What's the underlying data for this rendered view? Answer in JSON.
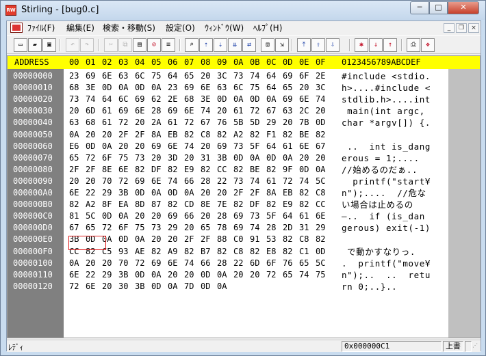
{
  "window": {
    "title": "Stirling - [bug0.c]"
  },
  "title_buttons": {
    "minimize": "─",
    "maximize": "□",
    "close": "✕"
  },
  "menu": {
    "items": [
      "ﾌｧｲﾙ(F)",
      "編集(E)",
      "検索・移動(S)",
      "設定(O)",
      "ｳｨﾝﾄﾞｳ(W)",
      "ﾍﾙﾌﾟ(H)"
    ],
    "mdi_buttons": [
      "_",
      "❐",
      "×"
    ]
  },
  "toolbar": {
    "buttons": [
      {
        "icon": "new-file-icon",
        "glyph": "▭",
        "style": ""
      },
      {
        "icon": "open-folder-icon",
        "glyph": "▰",
        "style": ""
      },
      {
        "icon": "save-icon",
        "glyph": "▣",
        "style": ""
      },
      {
        "icon": "undo-icon",
        "glyph": "↶",
        "style": "dis"
      },
      {
        "icon": "redo-icon",
        "glyph": "↷",
        "style": "dis"
      },
      {
        "icon": "cut-icon",
        "glyph": "✂",
        "style": "dis"
      },
      {
        "icon": "copy-icon",
        "glyph": "⧉",
        "style": "dis"
      },
      {
        "icon": "paste-icon",
        "glyph": "▤",
        "style": ""
      },
      {
        "icon": "delete-icon",
        "glyph": "⊘",
        "style": "red"
      },
      {
        "icon": "block-icon",
        "glyph": "≡",
        "style": ""
      },
      {
        "icon": "find-icon",
        "glyph": "⌕",
        "style": ""
      },
      {
        "icon": "find-prev-icon",
        "glyph": "⇡",
        "style": "blue"
      },
      {
        "icon": "find-next-icon",
        "glyph": "⇣",
        "style": "blue"
      },
      {
        "icon": "find-all-icon",
        "glyph": "⇊",
        "style": "blue"
      },
      {
        "icon": "replace-icon",
        "glyph": "⇄",
        "style": "blue"
      },
      {
        "icon": "compare-icon",
        "glyph": "⧈",
        "style": ""
      },
      {
        "icon": "jump-icon",
        "glyph": "⇲",
        "style": ""
      },
      {
        "icon": "top-icon",
        "glyph": "⤒",
        "style": "blue"
      },
      {
        "icon": "up-icon",
        "glyph": "⇧",
        "style": "blue"
      },
      {
        "icon": "down-icon",
        "glyph": "⇩",
        "style": "blue"
      },
      {
        "icon": "mark-icon",
        "glyph": "✱",
        "style": "red"
      },
      {
        "icon": "mark-next-icon",
        "glyph": "↓",
        "style": "red"
      },
      {
        "icon": "mark-prev-icon",
        "glyph": "↑",
        "style": "red"
      },
      {
        "icon": "print-icon",
        "glyph": "⎙",
        "style": ""
      },
      {
        "icon": "help-book-icon",
        "glyph": "❖",
        "style": "red"
      }
    ]
  },
  "editor": {
    "header_address": "ADDRESS",
    "header_columns": [
      "00",
      "01",
      "02",
      "03",
      "04",
      "05",
      "06",
      "07",
      "08",
      "09",
      "0A",
      "0B",
      "0C",
      "0D",
      "0E",
      "0F"
    ],
    "header_ascii": "0123456789ABCDEF",
    "rows": [
      {
        "addr": "00000000",
        "hex": [
          "23",
          "69",
          "6E",
          "63",
          "6C",
          "75",
          "64",
          "65",
          "20",
          "3C",
          "73",
          "74",
          "64",
          "69",
          "6F",
          "2E"
        ],
        "ascii": "#include <stdio."
      },
      {
        "addr": "00000010",
        "hex": [
          "68",
          "3E",
          "0D",
          "0A",
          "0D",
          "0A",
          "23",
          "69",
          "6E",
          "63",
          "6C",
          "75",
          "64",
          "65",
          "20",
          "3C"
        ],
        "ascii": "h>....#include <"
      },
      {
        "addr": "00000020",
        "hex": [
          "73",
          "74",
          "64",
          "6C",
          "69",
          "62",
          "2E",
          "68",
          "3E",
          "0D",
          "0A",
          "0D",
          "0A",
          "69",
          "6E",
          "74"
        ],
        "ascii": "stdlib.h>....int"
      },
      {
        "addr": "00000030",
        "hex": [
          "20",
          "6D",
          "61",
          "69",
          "6E",
          "28",
          "69",
          "6E",
          "74",
          "20",
          "61",
          "72",
          "67",
          "63",
          "2C",
          "20"
        ],
        "ascii": " main(int argc, "
      },
      {
        "addr": "00000040",
        "hex": [
          "63",
          "68",
          "61",
          "72",
          "20",
          "2A",
          "61",
          "72",
          "67",
          "76",
          "5B",
          "5D",
          "29",
          "20",
          "7B",
          "0D"
        ],
        "ascii": "char *argv[]) {."
      },
      {
        "addr": "00000050",
        "hex": [
          "0A",
          "20",
          "20",
          "2F",
          "2F",
          "8A",
          "EB",
          "82",
          "C8",
          "82",
          "A2",
          "82",
          "F1",
          "82",
          "BE",
          "82"
        ],
        "ascii": ""
      },
      {
        "addr": "00000060",
        "hex": [
          "E6",
          "0D",
          "0A",
          "20",
          "20",
          "69",
          "6E",
          "74",
          "20",
          "69",
          "73",
          "5F",
          "64",
          "61",
          "6E",
          "67"
        ],
        "ascii": " ..  int is_dang"
      },
      {
        "addr": "00000070",
        "hex": [
          "65",
          "72",
          "6F",
          "75",
          "73",
          "20",
          "3D",
          "20",
          "31",
          "3B",
          "0D",
          "0A",
          "0D",
          "0A",
          "20",
          "20"
        ],
        "ascii": "erous = 1;....  "
      },
      {
        "addr": "00000080",
        "hex": [
          "2F",
          "2F",
          "8E",
          "6E",
          "82",
          "DF",
          "82",
          "E9",
          "82",
          "CC",
          "82",
          "BE",
          "82",
          "9F",
          "0D",
          "0A"
        ],
        "ascii": "//始めるのだぁ.."
      },
      {
        "addr": "00000090",
        "hex": [
          "20",
          "20",
          "70",
          "72",
          "69",
          "6E",
          "74",
          "66",
          "28",
          "22",
          "73",
          "74",
          "61",
          "72",
          "74",
          "5C"
        ],
        "ascii": "  printf(\"start¥"
      },
      {
        "addr": "000000A0",
        "hex": [
          "6E",
          "22",
          "29",
          "3B",
          "0D",
          "0A",
          "0D",
          "0A",
          "20",
          "20",
          "2F",
          "2F",
          "8A",
          "EB",
          "82",
          "C8"
        ],
        "ascii": "n\");....  //危な"
      },
      {
        "addr": "000000B0",
        "hex": [
          "82",
          "A2",
          "8F",
          "EA",
          "8D",
          "87",
          "82",
          "CD",
          "8E",
          "7E",
          "82",
          "DF",
          "82",
          "E9",
          "82",
          "CC"
        ],
        "ascii": "い場合は止めるの"
      },
      {
        "addr": "000000C0",
        "hex": [
          "81",
          "5C",
          "0D",
          "0A",
          "20",
          "20",
          "69",
          "66",
          "20",
          "28",
          "69",
          "73",
          "5F",
          "64",
          "61",
          "6E"
        ],
        "ascii": "―..  if (is_dan"
      },
      {
        "addr": "000000D0",
        "hex": [
          "67",
          "65",
          "72",
          "6F",
          "75",
          "73",
          "29",
          "20",
          "65",
          "78",
          "69",
          "74",
          "28",
          "2D",
          "31",
          "29"
        ],
        "ascii": "gerous) exit(-1)"
      },
      {
        "addr": "000000E0",
        "hex": [
          "3B",
          "0D",
          "0A",
          "0D",
          "0A",
          "20",
          "20",
          "2F",
          "2F",
          "88",
          "C0",
          "91",
          "53",
          "82",
          "C8",
          "82"
        ],
        "ascii": ""
      },
      {
        "addr": "000000F0",
        "hex": [
          "CC",
          "82",
          "C5",
          "93",
          "AE",
          "82",
          "A9",
          "82",
          "B7",
          "82",
          "C8",
          "82",
          "E8",
          "82",
          "C1",
          "0D"
        ],
        "ascii": " で動かすなりっ."
      },
      {
        "addr": "00000100",
        "hex": [
          "0A",
          "20",
          "20",
          "70",
          "72",
          "69",
          "6E",
          "74",
          "66",
          "28",
          "22",
          "6D",
          "6F",
          "76",
          "65",
          "5C"
        ],
        "ascii": ".  printf(\"move¥"
      },
      {
        "addr": "00000110",
        "hex": [
          "6E",
          "22",
          "29",
          "3B",
          "0D",
          "0A",
          "20",
          "20",
          "0D",
          "0A",
          "20",
          "20",
          "72",
          "65",
          "74",
          "75"
        ],
        "ascii": "n\");..  ..  retu"
      },
      {
        "addr": "00000120",
        "hex": [
          "72",
          "6E",
          "20",
          "30",
          "3B",
          "0D",
          "0A",
          "7D",
          "0D",
          "0A"
        ],
        "ascii": "rn 0;..}.."
      }
    ]
  },
  "status": {
    "text": "ﾚﾃﾞｨ",
    "offset": "0x000000C1",
    "mode": "上書"
  }
}
